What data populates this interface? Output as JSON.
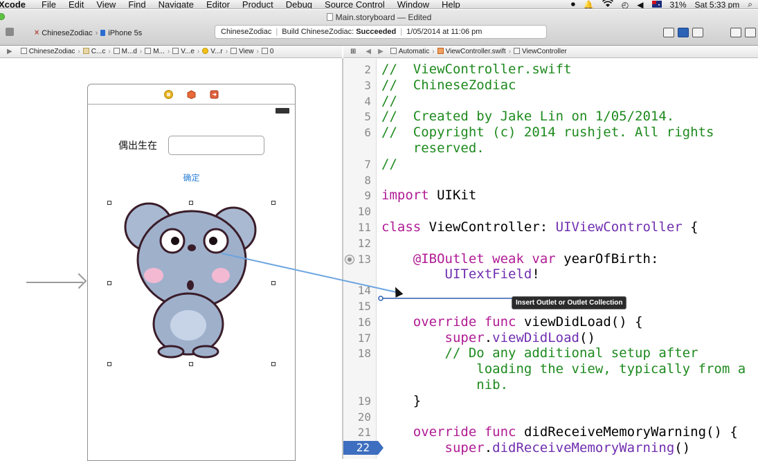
{
  "menubar": {
    "app": "Xcode",
    "items": [
      "File",
      "Edit",
      "View",
      "Find",
      "Navigate",
      "Editor",
      "Product",
      "Debug",
      "Source Control",
      "Window",
      "Help"
    ],
    "battery": "31%",
    "clock": "Sat 5:33 pm"
  },
  "window": {
    "title": "Main.storyboard — Edited"
  },
  "toolbar": {
    "scheme": "ChineseZodiac",
    "device": "iPhone 5s",
    "activity_project": "ChineseZodiac",
    "activity_build_prefix": "Build ChineseZodiac:",
    "activity_build_status": "Succeeded",
    "activity_time": "1/05/2014 at 11:06 pm"
  },
  "jumpbar_left": {
    "items": [
      "ChineseZodiac",
      "C...c",
      "M...d",
      "M...",
      "V...e",
      "V...r",
      "View",
      "0"
    ]
  },
  "jumpbar_right": {
    "mode": "Automatic",
    "file": "ViewController.swift",
    "symbol": "ViewController"
  },
  "scene": {
    "label": "偶出生在",
    "button": "确定"
  },
  "editor": {
    "lines": [
      {
        "n": "2",
        "segs": [
          {
            "t": "//  ViewController.swift",
            "c": "com"
          }
        ]
      },
      {
        "n": "3",
        "segs": [
          {
            "t": "//  ChineseZodiac",
            "c": "com"
          }
        ]
      },
      {
        "n": "4",
        "segs": [
          {
            "t": "//",
            "c": "com"
          }
        ]
      },
      {
        "n": "5",
        "segs": [
          {
            "t": "//  Created by Jake Lin on 1/05/2014.",
            "c": "com"
          }
        ]
      },
      {
        "n": "6",
        "segs": [
          {
            "t": "//  Copyright (c) 2014 rushjet. All rights",
            "c": "com"
          }
        ]
      },
      {
        "n": "",
        "segs": [
          {
            "t": "    reserved.",
            "c": "com"
          }
        ]
      },
      {
        "n": "7",
        "segs": [
          {
            "t": "//",
            "c": "com"
          }
        ]
      },
      {
        "n": "8",
        "segs": []
      },
      {
        "n": "9",
        "segs": [
          {
            "t": "import",
            "c": "kw"
          },
          {
            "t": " UIKit",
            "c": ""
          }
        ]
      },
      {
        "n": "10",
        "segs": []
      },
      {
        "n": "11",
        "segs": [
          {
            "t": "class",
            "c": "kw"
          },
          {
            "t": " ViewController: ",
            "c": ""
          },
          {
            "t": "UIViewController",
            "c": "ty"
          },
          {
            "t": " {",
            "c": ""
          }
        ]
      },
      {
        "n": "12",
        "segs": []
      },
      {
        "n": "13",
        "segs": [
          {
            "t": "    @IBOutlet",
            "c": "kw"
          },
          {
            "t": " ",
            "c": ""
          },
          {
            "t": "weak",
            "c": "kw"
          },
          {
            "t": " ",
            "c": ""
          },
          {
            "t": "var",
            "c": "kw"
          },
          {
            "t": " yearOfBirth:",
            "c": ""
          }
        ]
      },
      {
        "n": "",
        "segs": [
          {
            "t": "        ",
            "c": ""
          },
          {
            "t": "UITextField",
            "c": "ty"
          },
          {
            "t": "!",
            "c": ""
          }
        ]
      },
      {
        "n": "14",
        "segs": []
      },
      {
        "n": "15",
        "segs": []
      },
      {
        "n": "16",
        "segs": [
          {
            "t": "    override",
            "c": "kw"
          },
          {
            "t": " ",
            "c": ""
          },
          {
            "t": "func",
            "c": "kw"
          },
          {
            "t": " viewDidLoad() {",
            "c": ""
          }
        ]
      },
      {
        "n": "17",
        "segs": [
          {
            "t": "        super",
            "c": "kw"
          },
          {
            "t": ".",
            "c": ""
          },
          {
            "t": "viewDidLoad",
            "c": "ty"
          },
          {
            "t": "()",
            "c": ""
          }
        ]
      },
      {
        "n": "18",
        "segs": [
          {
            "t": "        // Do any additional setup after",
            "c": "com"
          }
        ]
      },
      {
        "n": "",
        "segs": [
          {
            "t": "            loading the view, typically from a",
            "c": "com"
          }
        ]
      },
      {
        "n": "",
        "segs": [
          {
            "t": "            nib.",
            "c": "com"
          }
        ]
      },
      {
        "n": "19",
        "segs": [
          {
            "t": "    }",
            "c": ""
          }
        ]
      },
      {
        "n": "20",
        "segs": []
      },
      {
        "n": "21",
        "segs": [
          {
            "t": "    override",
            "c": "kw"
          },
          {
            "t": " ",
            "c": ""
          },
          {
            "t": "func",
            "c": "kw"
          },
          {
            "t": " didReceiveMemoryWarning() {",
            "c": ""
          }
        ]
      },
      {
        "n": "22",
        "segs": [
          {
            "t": "        super",
            "c": "kw"
          },
          {
            "t": ".",
            "c": ""
          },
          {
            "t": "didReceiveMemoryWarning",
            "c": "ty"
          },
          {
            "t": "()",
            "c": ""
          }
        ]
      }
    ],
    "current_line": "22",
    "breakpoint_line": "13"
  },
  "connection": {
    "tooltip": "Insert Outlet or Outlet Collection"
  },
  "colors": {
    "comment": "#1e8a1e",
    "keyword": "#b01b94",
    "type": "#6f2eb0",
    "link": "#2a7fd6",
    "current_line": "#3d6ebf"
  }
}
